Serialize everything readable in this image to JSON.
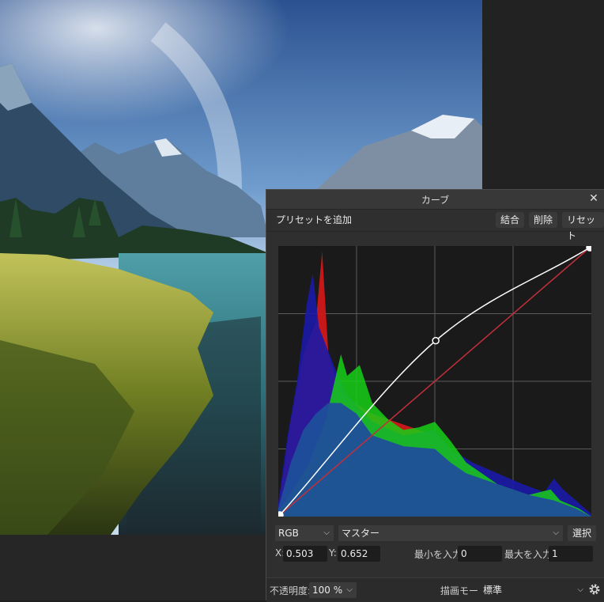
{
  "panel": {
    "title": "カーブ",
    "close_glyph": "✕",
    "toolbar": {
      "add_preset": "プリセットを追加",
      "merge": "結合",
      "delete": "削除",
      "reset": "リセット"
    },
    "channel": "RGB",
    "mode": "マスター",
    "select_btn": "選択",
    "x_label": "X:",
    "x_value": "0.503",
    "y_label": "Y:",
    "y_value": "0.652",
    "min_label": "最小を入力:",
    "min_value": "0",
    "max_label": "最大を入力:",
    "max_value": "1",
    "footer": {
      "opacity_label": "不透明度:",
      "opacity_value": "100 %",
      "blend_label": "描画モード:",
      "blend_value": "標準"
    },
    "icons": {
      "close": "close-icon",
      "chevron": "chevron-down-icon",
      "gear": "gear-icon"
    }
  },
  "curve": {
    "points": [
      [
        0,
        0
      ],
      [
        0.503,
        0.652
      ],
      [
        1,
        1
      ]
    ],
    "selected_point": 1,
    "curve_color": "#ffffff",
    "diagonal_color": "#c0303a"
  },
  "histogram_colors": {
    "red": "#d01818",
    "green": "#18d018",
    "blue": "#1a1aa8",
    "overlap": "#1f4f9a"
  },
  "photo": {
    "sky_top": "#2b5290",
    "lake": "#3d8b96",
    "grass": "#8d9b2a"
  }
}
